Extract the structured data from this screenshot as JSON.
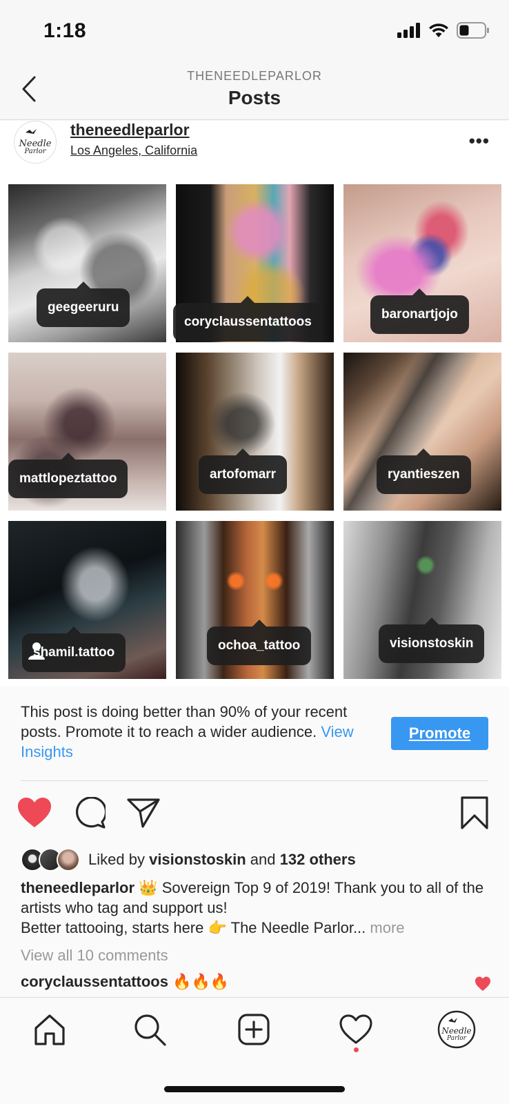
{
  "status_bar": {
    "time": "1:18"
  },
  "header": {
    "subtitle": "THENEEDLEPARLOR",
    "title": "Posts"
  },
  "post": {
    "username": "theneedleparlor",
    "location": "Los Angeles, California",
    "more_label": "•••",
    "tags": [
      "geegeeruru",
      "coryclaussentattoos",
      "baronartjojo",
      "mattlopeztattoo",
      "artofomarr",
      "ryantieszen",
      "shamil.tattoo",
      "ochoa_tattoo",
      "visionstoskin"
    ]
  },
  "promo": {
    "text": "This post is doing better than 90% of your recent posts. Promote it to reach a wider audience.",
    "link": "View Insights",
    "button": "Promote"
  },
  "likes": {
    "prefix": "Liked by",
    "user": "visionstoskin",
    "joiner": "and",
    "others": "132 others"
  },
  "caption": {
    "username": "theneedleparlor",
    "emoji": "👑",
    "line1": "Sovereign Top 9 of 2019! Thank you to all of the artists who tag and support us!",
    "line2_start": "Better tattooing, starts here",
    "line2_emoji": "👉",
    "line2_end": "The Needle Parlor...",
    "more": "more"
  },
  "comments": {
    "view_all": "View all 10 comments",
    "first_user": "coryclaussentattoos",
    "first_text": "🔥🔥🔥"
  },
  "colors": {
    "accent": "#3897f0",
    "like": "#ed4956",
    "text": "#262626",
    "muted": "#999999"
  },
  "tab_bar": {
    "icons": [
      "home-icon",
      "search-icon",
      "new-post-icon",
      "activity-icon",
      "profile-icon"
    ]
  }
}
